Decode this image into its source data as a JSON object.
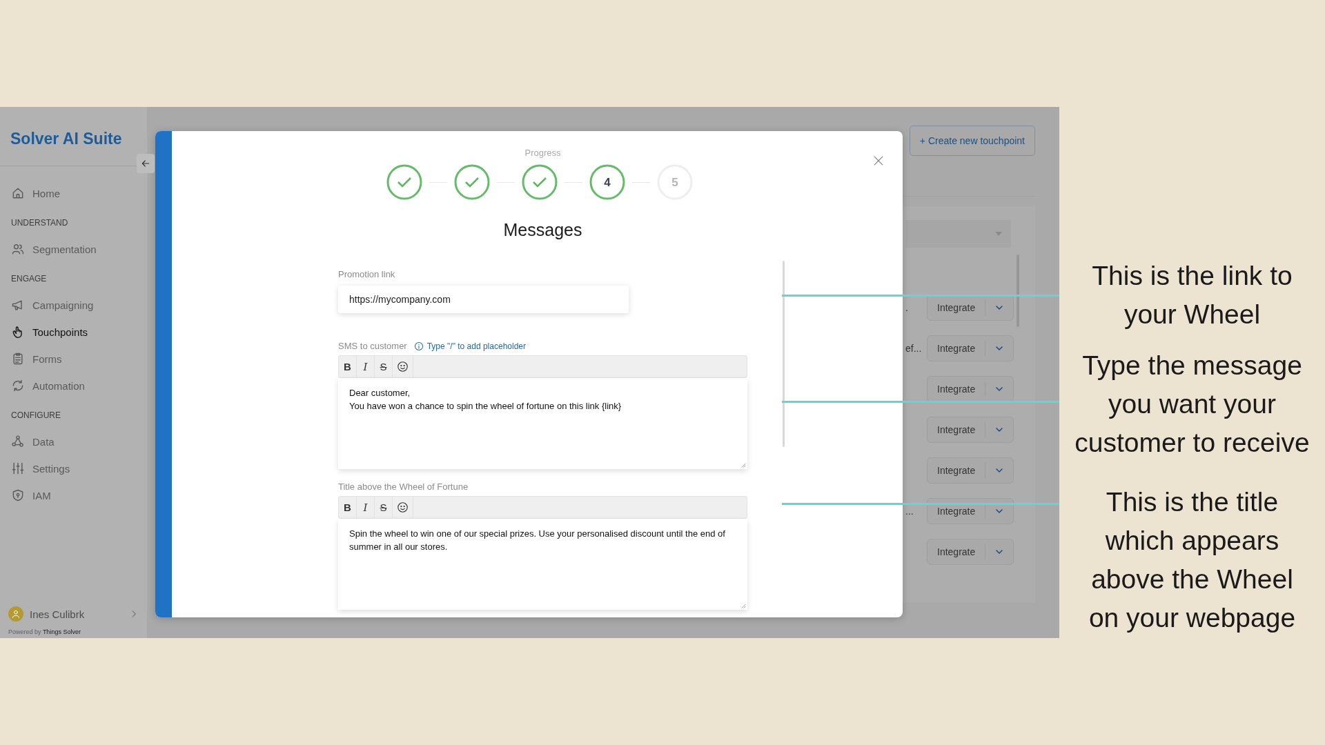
{
  "sidebar": {
    "brand": "Solver AI Suite",
    "sections": [
      {
        "items": [
          {
            "label": "Home",
            "selected": false
          }
        ]
      },
      {
        "heading": "UNDERSTAND",
        "items": [
          {
            "label": "Segmentation",
            "selected": false
          }
        ]
      },
      {
        "heading": "ENGAGE",
        "items": [
          {
            "label": "Campaigning",
            "selected": false
          },
          {
            "label": "Touchpoints",
            "selected": true
          },
          {
            "label": "Forms",
            "selected": false
          },
          {
            "label": "Automation",
            "selected": false
          }
        ]
      },
      {
        "heading": "CONFIGURE",
        "items": [
          {
            "label": "Data",
            "selected": false
          },
          {
            "label": "Settings",
            "selected": false
          },
          {
            "label": "IAM",
            "selected": false
          }
        ]
      }
    ],
    "user": {
      "name": "Ines Culibrk"
    },
    "footer": {
      "prefix": "Powered by",
      "link": "Things Solver"
    }
  },
  "background": {
    "create_button": "+ Create new touchpoint",
    "rows": [
      {
        "text": ".",
        "button": "Integrate"
      },
      {
        "text": "ef...",
        "button": "Integrate"
      },
      {
        "button": "Integrate"
      },
      {
        "button": "Integrate"
      },
      {
        "button": "Integrate"
      },
      {
        "text": "...",
        "button": "Integrate"
      },
      {
        "button": "Integrate"
      }
    ]
  },
  "modal": {
    "progress_label": "Progress",
    "steps": [
      {
        "kind": "done"
      },
      {
        "kind": "done"
      },
      {
        "kind": "done"
      },
      {
        "kind": "current",
        "number": "4"
      },
      {
        "kind": "upcoming",
        "number": "5"
      }
    ],
    "title": "Messages",
    "fields": [
      {
        "kind": "input",
        "label": "Promotion link",
        "value": "https://mycompany.com"
      },
      {
        "kind": "editor",
        "label": "SMS to customer",
        "hint": "Type \"/\" to add placeholder",
        "tools": [
          {
            "kind": "bold",
            "label": "B"
          },
          {
            "kind": "italic",
            "label": "I"
          },
          {
            "kind": "strike",
            "label": "S"
          },
          {
            "kind": "emoji"
          }
        ],
        "lines": [
          "Dear customer,",
          "You have won a chance to spin the wheel of fortune on this link {link}"
        ]
      },
      {
        "kind": "editor",
        "label": "Title above the Wheel of Fortune",
        "tools": [
          {
            "kind": "bold",
            "label": "B"
          },
          {
            "kind": "italic",
            "label": "I"
          },
          {
            "kind": "strike",
            "label": "S"
          },
          {
            "kind": "emoji"
          }
        ],
        "lines": [
          "Spin the wheel to win one of our special prizes. Use your personalised discount until the end of summer in all our stores."
        ]
      }
    ]
  },
  "annotations": [
    {
      "lines": [
        "This is the link to",
        "your Wheel"
      ]
    },
    {
      "lines": [
        "Type the message",
        "you want your",
        "customer to receive"
      ]
    },
    {
      "lines": [
        "This is the title",
        "which appears",
        "above the Wheel",
        "on your webpage"
      ]
    }
  ]
}
